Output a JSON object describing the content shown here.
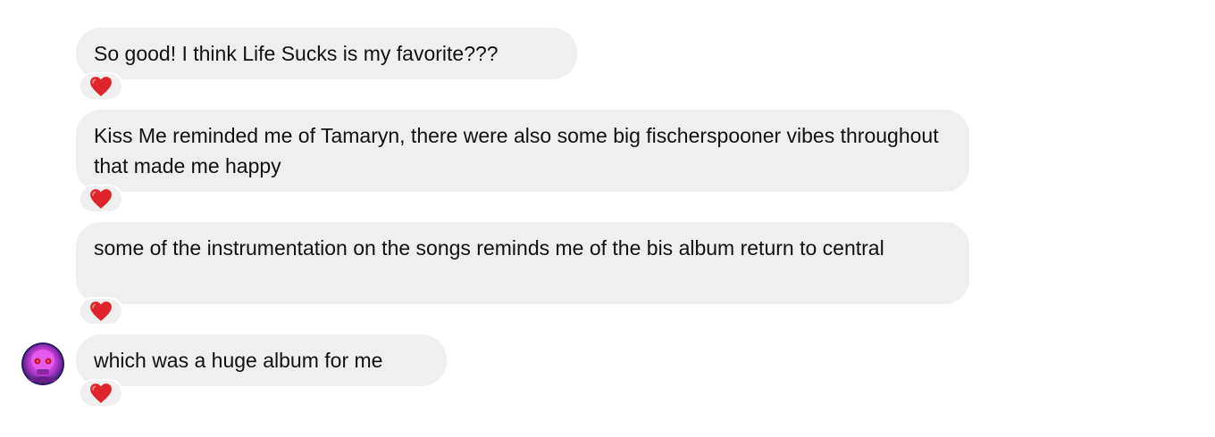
{
  "messages": [
    {
      "text": "So good! I think Life Sucks is my favorite???",
      "reaction": "heart-icon"
    },
    {
      "text": "Kiss Me reminded me of Tamaryn, there were also some big fischerspooner vibes throughout that made me happy",
      "reaction": "heart-icon"
    },
    {
      "text": "some of the instrumentation on the songs reminds me of the bis album return to central",
      "reaction": "heart-icon"
    },
    {
      "text": "which was a huge album for me",
      "reaction": "heart-icon"
    }
  ],
  "colors": {
    "bubble_bg": "#efefef",
    "text": "#111111",
    "heart": "#e0242e",
    "avatar_primary": "#d04be0",
    "avatar_bg": "#2a1a66"
  }
}
